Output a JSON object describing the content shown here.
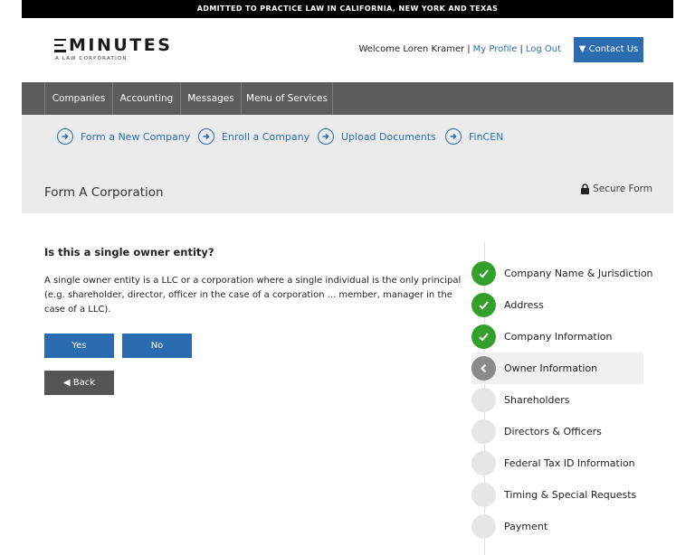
{
  "topbar": {
    "text": "ADMITTED TO PRACTICE LAW IN CALIFORNIA, NEW YORK AND TEXAS"
  },
  "logo": {
    "main": "MINUTES",
    "sub": "A LAW CORPORATION"
  },
  "header": {
    "welcome": "Welcome Loren Kramer",
    "separator": "|",
    "my_profile": "My Profile",
    "log_out": "Log Out",
    "contact_button": "▼ Contact Us"
  },
  "nav": {
    "items": [
      "Companies",
      "Accounting",
      "Messages",
      "Menu of Services"
    ]
  },
  "subnav": {
    "links": [
      "Form a New Company",
      "Enroll a Company",
      "Upload Documents",
      "FinCEN"
    ],
    "page_title": "Form A Corporation",
    "secure_label": "Secure Form"
  },
  "question": {
    "title": "Is this a single owner entity?",
    "description": "A single owner entity is a LLC or a corporation where a single individual is the only principal (e.g. shareholder, director, officer in the case of a corporation ... member, manager in the case of a LLC).",
    "yes_label": "Yes",
    "no_label": "No",
    "back_label": "◀ Back"
  },
  "steps": [
    {
      "label": "Company Name & Jurisdiction",
      "status": "done"
    },
    {
      "label": "Address",
      "status": "done"
    },
    {
      "label": "Company Information",
      "status": "done"
    },
    {
      "label": "Owner Information",
      "status": "current"
    },
    {
      "label": "Shareholders",
      "status": "pending"
    },
    {
      "label": "Directors & Officers",
      "status": "pending"
    },
    {
      "label": "Federal Tax ID Information",
      "status": "pending"
    },
    {
      "label": "Timing & Special Requests",
      "status": "pending"
    },
    {
      "label": "Payment",
      "status": "pending"
    }
  ],
  "colors": {
    "brand_blue": "#2b6cb0",
    "link_blue": "#2a6fb5",
    "nav_gray": "#5c5c5c",
    "done_green": "#34a02c",
    "current_gray": "#8a8a8a"
  }
}
